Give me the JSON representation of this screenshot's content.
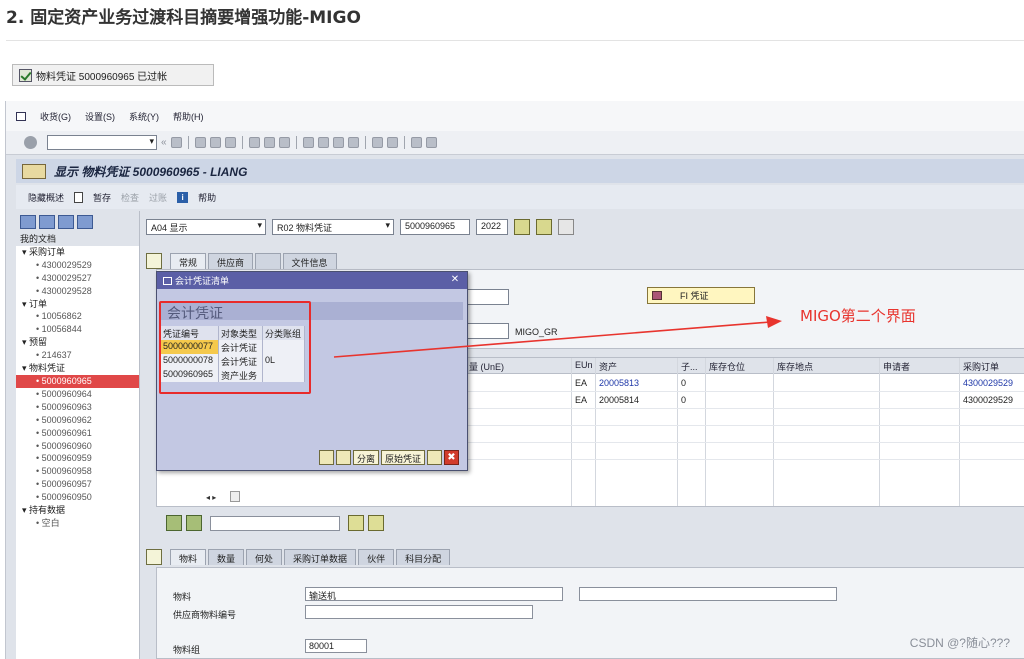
{
  "article": {
    "heading": "2. 固定资产业务过渡科目摘要增强功能-MIGO",
    "status_message": "物料凭证 5000960965 已过帐",
    "watermark": "CSDN @?随心???",
    "annotation": "MIGO第二个界面"
  },
  "menu": [
    "收货(G)",
    "设置(S)",
    "系统(Y)",
    "帮助(H)"
  ],
  "window": {
    "title": "显示 物料凭证 5000960965 - LIANG"
  },
  "app_toolbar": {
    "hide_overview": "隐藏概述",
    "hold": "暂存",
    "check": "检查",
    "post": "过账",
    "help": "帮助"
  },
  "sidebar": {
    "root": "我的文档",
    "groups": [
      {
        "label": "采购订单",
        "items": [
          "4300029529",
          "4300029527",
          "4300029528"
        ]
      },
      {
        "label": "订单",
        "items": [
          "10056862",
          "10056844"
        ]
      },
      {
        "label": "预留",
        "items": [
          "214637"
        ]
      },
      {
        "label": "物料凭证",
        "items": [
          "5000960965",
          "5000960964",
          "5000960963",
          "5000960962",
          "5000960961",
          "5000960960",
          "5000960959",
          "5000960958",
          "5000960957",
          "5000960950"
        ]
      },
      {
        "label": "持有数据",
        "items": [
          "空白"
        ]
      }
    ],
    "selected": "5000960965"
  },
  "selection": {
    "action": "A04 显示",
    "reference": "R02 物料凭证",
    "document": "5000960965",
    "year": "2022"
  },
  "header_tabs": [
    "常规",
    "供应商",
    "文件信息"
  ],
  "header_panel": {
    "fi_button": "FI 凭证",
    "text_value": "MIGO_GR"
  },
  "grid": {
    "columns": [
      "量 (UnE)",
      "EUn",
      "资产",
      "子...",
      "库存仓位",
      "库存地点",
      "申请者",
      "采购订单"
    ],
    "rows": [
      {
        "eun": "EA",
        "asset": "20005813",
        "sub": "0",
        "po": "4300029529"
      },
      {
        "eun": "EA",
        "asset": "20005814",
        "sub": "0",
        "po": "4300029529"
      }
    ]
  },
  "item_tabs": [
    "物料",
    "数量",
    "何处",
    "采购订单数据",
    "伙伴",
    "科目分配"
  ],
  "item_panel": {
    "material_label": "物料",
    "material_value": "输送机",
    "vendor_material_label": "供应商物料编号",
    "material_group_label": "物料组",
    "material_group_value": "80001"
  },
  "popup": {
    "title": "会计凭证清单",
    "header": "会计凭证",
    "columns": [
      "凭证编号",
      "对象类型",
      "分类账组"
    ],
    "rows": [
      {
        "doc": "5000000077",
        "type": "会计凭证",
        "ledger": ""
      },
      {
        "doc": "5000000078",
        "type": "会计凭证",
        "ledger": "0L"
      },
      {
        "doc": "5000960965",
        "type": "资产业务",
        "ledger": ""
      }
    ],
    "buttons": {
      "split": "分离",
      "original": "原始凭证"
    }
  },
  "colors": {
    "accent_red": "#e8342e",
    "popup_title": "#5b5fa6",
    "highlight": "#f5c94c"
  }
}
